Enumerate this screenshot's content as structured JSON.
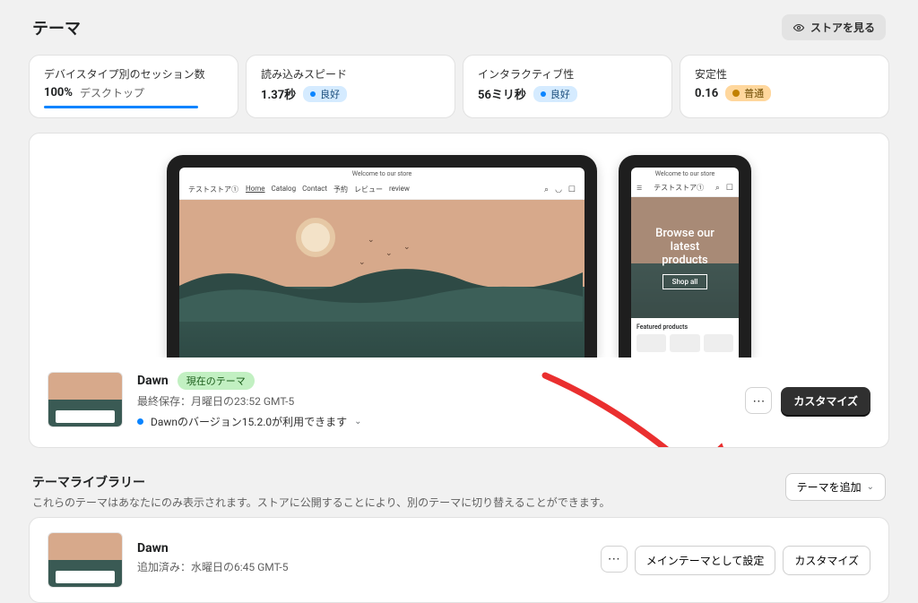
{
  "header": {
    "title": "テーマ",
    "view_store": "ストアを見る"
  },
  "metrics": {
    "sessions": {
      "label": "デバイスタイプ別のセッション数",
      "value": "100%",
      "sub": "デスクトップ"
    },
    "speed": {
      "label": "読み込みスピード",
      "value": "1.37秒",
      "badge": "良好"
    },
    "interactive": {
      "label": "インタラクティブ性",
      "value": "56ミリ秒",
      "badge": "良好"
    },
    "stability": {
      "label": "安定性",
      "value": "0.16",
      "badge": "普通"
    }
  },
  "mock": {
    "announcement": "Welcome to our store",
    "brand": "テストストア①",
    "links": [
      "Home",
      "Catalog",
      "Contact",
      "予約",
      "レビュー",
      "review"
    ],
    "mobile_brand": "テストストア①",
    "hero_line1": "Browse our latest",
    "hero_line2": "products",
    "hero_btn": "Shop all",
    "featured": "Featured products"
  },
  "current": {
    "name": "Dawn",
    "badge": "現在のテーマ",
    "saved": "最終保存：月曜日の23:52 GMT-5",
    "update": "Dawnのバージョン15.2.0が利用できます",
    "customize": "カスタマイズ"
  },
  "library": {
    "title": "テーマライブラリー",
    "desc": "これらのテーマはあなたにのみ表示されます。ストアに公開することにより、別のテーマに切り替えることができます。",
    "add": "テーマを追加",
    "theme": {
      "name": "Dawn",
      "added": "追加済み：水曜日の6:45 GMT-5",
      "set_main": "メインテーマとして設定",
      "customize": "カスタマイズ"
    }
  }
}
